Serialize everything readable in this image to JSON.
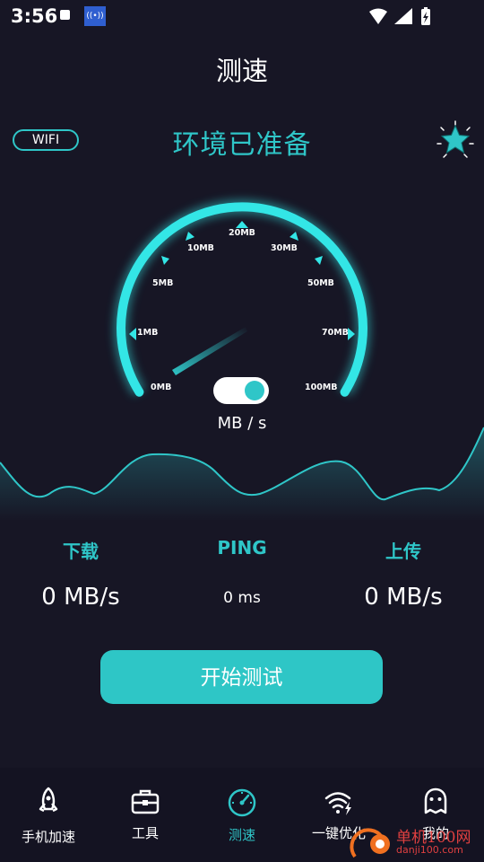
{
  "status_bar": {
    "time": "3:56",
    "radio_icon_text": "((•))"
  },
  "header": {
    "title": "测速"
  },
  "environment": {
    "network_type": "WIFI",
    "status_text": "环境已准备"
  },
  "gauge": {
    "ticks": [
      "0MB",
      "1MB",
      "5MB",
      "10MB",
      "20MB",
      "30MB",
      "50MB",
      "70MB",
      "100MB"
    ],
    "unit": "MB / s",
    "toggle_on": true,
    "accent_color": "#2fc6c8"
  },
  "stats": {
    "download": {
      "label": "下载",
      "value": "0 MB/s"
    },
    "ping": {
      "label": "PING",
      "value": "0 ms"
    },
    "upload": {
      "label": "上传",
      "value": "0 MB/s"
    }
  },
  "actions": {
    "start_label": "开始测试"
  },
  "nav": {
    "items": [
      {
        "label": "手机加速",
        "icon": "rocket-icon"
      },
      {
        "label": "工具",
        "icon": "toolbox-icon"
      },
      {
        "label": "测速",
        "icon": "speedometer-icon",
        "active": true
      },
      {
        "label": "一键优化",
        "icon": "wifi-boost-icon"
      },
      {
        "label": "我的",
        "icon": "profile-icon"
      }
    ]
  },
  "watermark": {
    "text": "单机100网",
    "sub": "danji100.com"
  },
  "colors": {
    "background": "#171625",
    "accent": "#2fc6c8",
    "button": "#2ec6c6"
  }
}
